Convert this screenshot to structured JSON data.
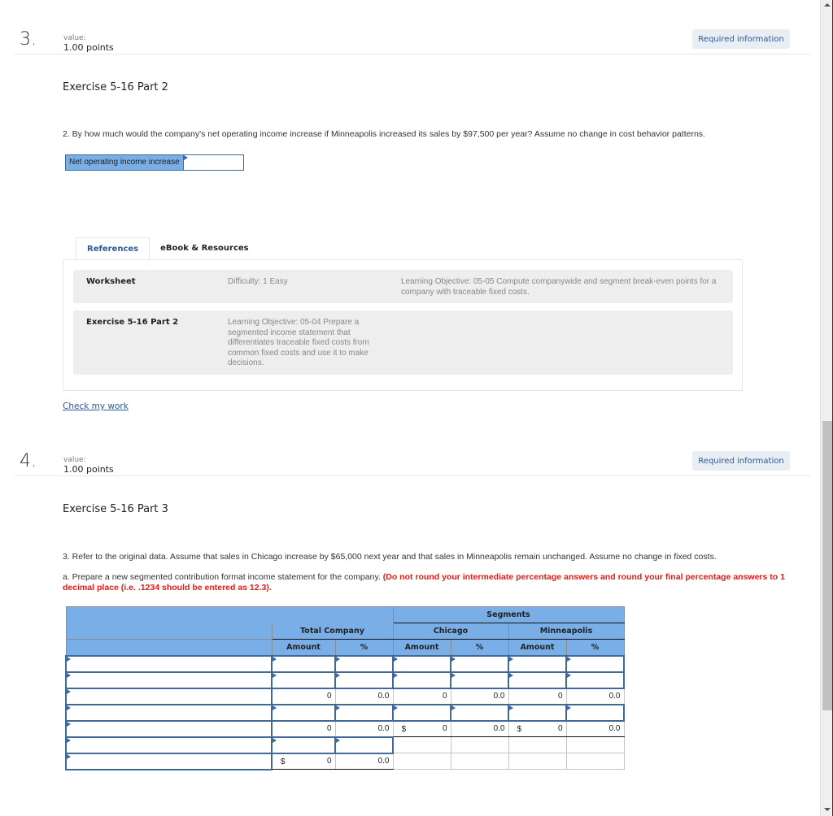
{
  "questions": [
    {
      "number": "3.",
      "value_label": "value:",
      "points": "1.00 points",
      "required_info": "Required information",
      "exercise_title": "Exercise 5-16 Part 2",
      "question_text": "2. By how much would the company's net operating income increase if Minneapolis increased its sales by $97,500 per year? Assume no change in cost behavior patterns.",
      "answer_label": "Net operating income increase",
      "answer_value": "",
      "tabs": [
        {
          "label": "References",
          "active": true
        },
        {
          "label": "eBook & Resources",
          "active": false
        }
      ],
      "references": [
        {
          "name": "Worksheet",
          "difficulty": "Difficulty: 1 Easy",
          "objective": "Learning Objective: 05-05 Compute companywide and segment break-even points for a company with traceable fixed costs."
        },
        {
          "name": "Exercise 5-16 Part 2",
          "objective": "Learning Objective: 05-04 Prepare a segmented income statement that differentiates traceable fixed costs from common fixed costs and use it to make decisions."
        }
      ],
      "check_link": "Check my work"
    },
    {
      "number": "4.",
      "value_label": "value:",
      "points": "1.00 points",
      "required_info": "Required information",
      "exercise_title": "Exercise 5-16 Part 3",
      "question_text": "3. Refer to the original data. Assume that sales in Chicago increase by $65,000 next year and that sales in Minneapolis remain unchanged. Assume no change in fixed costs.",
      "instruction_text": "a. Prepare a new segmented contribution format income statement for the company.",
      "instruction_red": "(Do not round your intermediate percentage answers and round your final percentage answers to 1 decimal place (i.e. .1234 should be entered as 12.3).",
      "table": {
        "segments_header": "Segments",
        "groups": [
          "Total Company",
          "Chicago",
          "Minneapolis"
        ],
        "subheaders": [
          "Amount",
          "%",
          "Amount",
          "%",
          "Amount",
          "%"
        ],
        "rows": [
          {
            "type": "input"
          },
          {
            "type": "input"
          },
          {
            "type": "calc",
            "values": [
              "0",
              "0.0",
              "0",
              "0.0",
              "0",
              "0.0"
            ],
            "dollar": [
              false,
              false,
              false
            ]
          },
          {
            "type": "input"
          },
          {
            "type": "calc",
            "values": [
              "0",
              "0.0",
              "0",
              "0.0",
              "0",
              "0.0"
            ],
            "dollar": [
              false,
              true,
              true
            ]
          },
          {
            "type": "input-total"
          },
          {
            "type": "calc-total",
            "values": [
              "0",
              "0.0"
            ],
            "dollar": [
              true
            ]
          }
        ],
        "dollar_sign": "$"
      }
    }
  ],
  "colors": {
    "accent": "#2a5b9c",
    "header_blue": "#7aaee6",
    "warning_red": "#e21a1a"
  }
}
